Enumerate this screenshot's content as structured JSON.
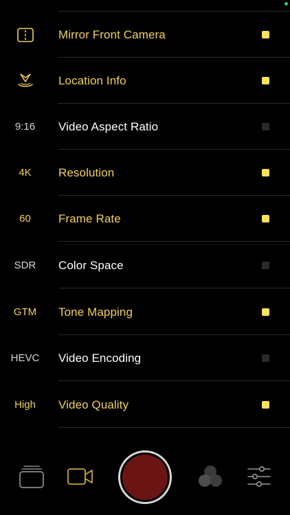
{
  "colors": {
    "background": "#000000",
    "accent": "#f2d15a",
    "toggle_on": "#ffe25c",
    "toggle_off": "#2a2a2a",
    "divider": "#2b2b2b",
    "record": "#6b1414"
  },
  "settings": [
    {
      "lead_icon": "mirror-icon",
      "lead_text": "",
      "label": "Mirror Front Camera",
      "enabled": true
    },
    {
      "lead_icon": "location-pin-icon",
      "lead_text": "",
      "label": "Location Info",
      "enabled": true
    },
    {
      "lead_icon": "",
      "lead_text": "9:16",
      "label": "Video Aspect Ratio",
      "enabled": false
    },
    {
      "lead_icon": "",
      "lead_text": "4K",
      "label": "Resolution",
      "enabled": true
    },
    {
      "lead_icon": "",
      "lead_text": "60",
      "label": "Frame Rate",
      "enabled": true
    },
    {
      "lead_icon": "",
      "lead_text": "SDR",
      "label": "Color Space",
      "enabled": false
    },
    {
      "lead_icon": "",
      "lead_text": "GTM",
      "label": "Tone Mapping",
      "enabled": true
    },
    {
      "lead_icon": "",
      "lead_text": "HEVC",
      "label": "Video Encoding",
      "enabled": false
    },
    {
      "lead_icon": "",
      "lead_text": "High",
      "label": "Video Quality",
      "enabled": true
    }
  ],
  "bottom_bar": {
    "items": [
      {
        "icon": "gallery-stack-icon"
      },
      {
        "icon": "video-camera-icon"
      },
      {
        "icon": "record-button"
      },
      {
        "icon": "filters-icon"
      },
      {
        "icon": "sliders-icon"
      }
    ]
  }
}
